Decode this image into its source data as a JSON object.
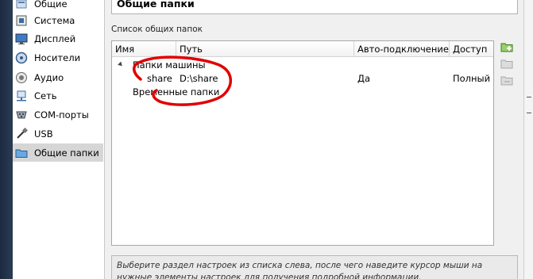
{
  "sidebar": {
    "items": [
      {
        "label": "Общие",
        "icon": "general-icon"
      },
      {
        "label": "Система",
        "icon": "system-icon"
      },
      {
        "label": "Дисплей",
        "icon": "display-icon"
      },
      {
        "label": "Носители",
        "icon": "storage-icon"
      },
      {
        "label": "Аудио",
        "icon": "audio-icon"
      },
      {
        "label": "Сеть",
        "icon": "network-icon"
      },
      {
        "label": "COM-порты",
        "icon": "serial-ports-icon"
      },
      {
        "label": "USB",
        "icon": "usb-icon"
      },
      {
        "label": "Общие папки",
        "icon": "shared-folders-icon",
        "selected": true
      }
    ]
  },
  "page": {
    "title": "Общие папки",
    "group_label": "Список общих папок"
  },
  "table": {
    "columns": [
      "Имя",
      "Путь",
      "Авто-подключение",
      "Доступ"
    ],
    "groups": [
      {
        "label": "Папки машины",
        "expanded": true,
        "rows": [
          {
            "name": "share",
            "path": "D:\\share",
            "auto_mount": "Да",
            "access": "Полный"
          }
        ]
      },
      {
        "label": "Временные папки",
        "expanded": false,
        "rows": []
      }
    ]
  },
  "toolbar": {
    "buttons": [
      {
        "icon": "add-shared-folder-icon",
        "enabled": true
      },
      {
        "icon": "edit-shared-folder-icon",
        "enabled": false
      },
      {
        "icon": "remove-shared-folder-icon",
        "enabled": false
      }
    ]
  },
  "info": {
    "text": "Выберите раздел настроек из списка слева, после чего наведите курсор мыши на нужные элементы настроек для получения подробной информации."
  },
  "colors": {
    "selected_bg": "#d6d6d6",
    "annotation_red": "#e00000"
  }
}
